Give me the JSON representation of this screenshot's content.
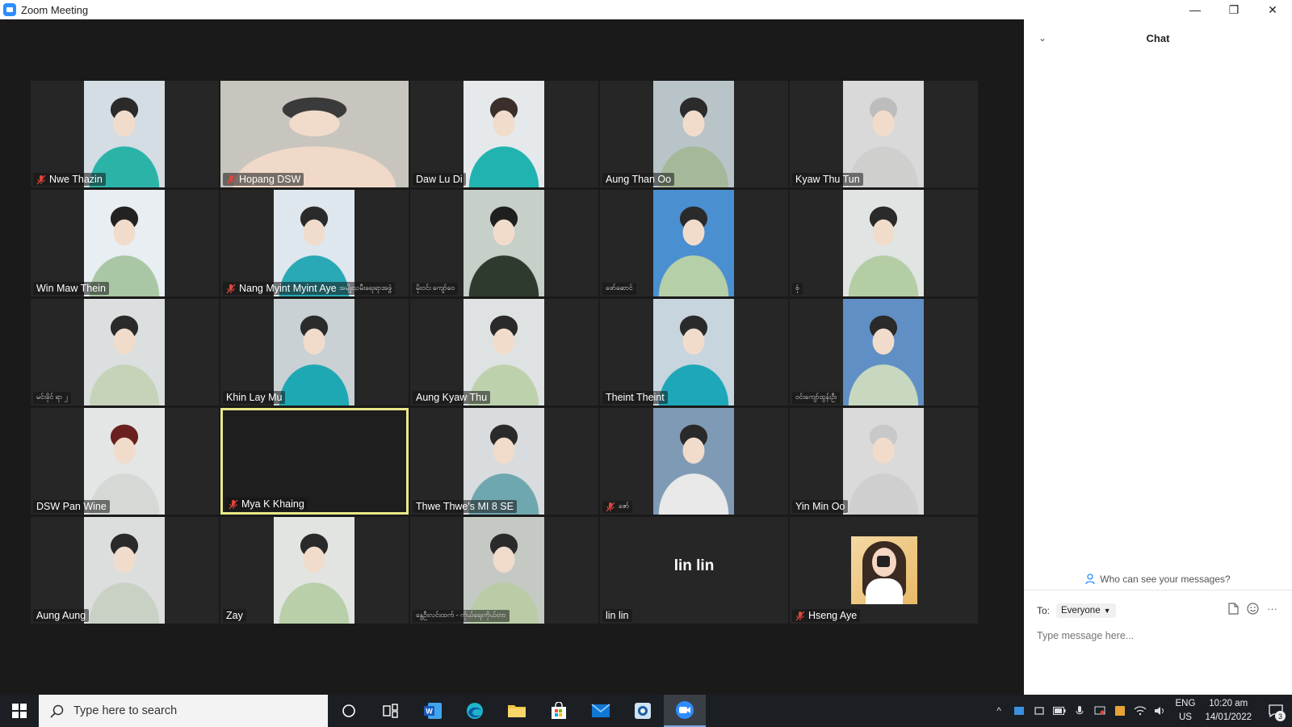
{
  "window": {
    "title": "Zoom Meeting",
    "minimize": "—",
    "restore": "❐",
    "close": "✕"
  },
  "participants": [
    {
      "name": "Nwe Thazin",
      "muted": true,
      "style": "person",
      "colors": [
        "#d4dde4",
        "#2bb3a8",
        "#2a2a2a"
      ]
    },
    {
      "name": "Hopang DSW",
      "muted": true,
      "style": "wide",
      "colors": [
        "#c8c4be",
        "#f1d9c9",
        "#3a3a3a"
      ]
    },
    {
      "name": "Daw Lu Di",
      "muted": false,
      "style": "person",
      "colors": [
        "#e6e9ec",
        "#20b3b0",
        "#3a2f2a"
      ]
    },
    {
      "name": "Aung Than Oo",
      "muted": false,
      "style": "person",
      "colors": [
        "#b9c4c9",
        "#a6b89a",
        "#2b2b2b"
      ]
    },
    {
      "name": "Kyaw Thu Tun",
      "muted": false,
      "style": "person",
      "colors": [
        "#d9d9d9",
        "#cfd0ce",
        "#bdbdbd"
      ]
    },
    {
      "name": "Win Maw Thein",
      "muted": false,
      "style": "person",
      "colors": [
        "#e8eef2",
        "#a9c7a4",
        "#222222"
      ]
    },
    {
      "name": "Nang Myint Myint Aye",
      "suffix": "အမျိုးသမီးရေးရာအဖွဲ့",
      "muted": true,
      "style": "person",
      "colors": [
        "#dfe7ee",
        "#28a9b5",
        "#2a2a2a"
      ]
    },
    {
      "name": "မိုးဝင်း ကျော်ဝေ",
      "muted": false,
      "style": "person",
      "small": true,
      "colors": [
        "#c6cfc8",
        "#2e3a2e",
        "#1f1f1f"
      ]
    },
    {
      "name": "ဖော်ဆောင်",
      "muted": false,
      "style": "person",
      "small": true,
      "colors": [
        "#4a8fd0",
        "#b5cfa8",
        "#2a2a2a"
      ]
    },
    {
      "name": "စုံ",
      "muted": false,
      "style": "person",
      "small": true,
      "colors": [
        "#e0e4e2",
        "#b4cda4",
        "#2a2a2a"
      ]
    },
    {
      "name": "မင်းခိုင် ရာ ၂",
      "muted": false,
      "style": "person",
      "small": true,
      "colors": [
        "#dcdfe0",
        "#c7d3b8",
        "#2a2a2a"
      ]
    },
    {
      "name": "Khin Lay Mu",
      "muted": false,
      "style": "person",
      "colors": [
        "#c9d1d4",
        "#1ea8b3",
        "#2b2b2b"
      ]
    },
    {
      "name": "Aung Kyaw Thu",
      "muted": false,
      "style": "person",
      "colors": [
        "#dfe2e3",
        "#bdd1ad",
        "#2a2a2a"
      ]
    },
    {
      "name": "Theint Theint",
      "muted": false,
      "style": "person",
      "colors": [
        "#c7d5de",
        "#1da7b8",
        "#2a2a2a"
      ]
    },
    {
      "name": "ဝင်းကျော်ထွန်းဦး",
      "muted": false,
      "style": "person",
      "small": true,
      "colors": [
        "#5f8fc4",
        "#c8d8c0",
        "#2a2a2a"
      ]
    },
    {
      "name": "DSW Pan Wine",
      "muted": false,
      "style": "person",
      "colors": [
        "#e3e6e4",
        "#d5d9d6",
        "#6b2020"
      ]
    },
    {
      "name": "Mya K Khaing",
      "muted": true,
      "style": "blank",
      "active": true,
      "colors": [
        "#1e1e1e",
        "#1e1e1e",
        "#1e1e1e"
      ]
    },
    {
      "name": "Thwe Thwe's MI 8 SE",
      "muted": false,
      "style": "person",
      "colors": [
        "#d9dcde",
        "#6fa7b0",
        "#2a2a2a"
      ]
    },
    {
      "name": "ဇော်",
      "muted": true,
      "style": "person",
      "small": true,
      "colors": [
        "#7f9ab5",
        "#e9e9e9",
        "#2a2a2a"
      ]
    },
    {
      "name": "Yin Min Oo",
      "muted": false,
      "style": "person",
      "colors": [
        "#dadada",
        "#cfcfcf",
        "#c8c8c8"
      ]
    },
    {
      "name": "Aung Aung",
      "muted": false,
      "style": "person",
      "colors": [
        "#dcdedd",
        "#c9d0c4",
        "#2a2a2a"
      ]
    },
    {
      "name": "Zay",
      "muted": false,
      "style": "person",
      "colors": [
        "#e2e4e2",
        "#b8cfa9",
        "#2a2a2a"
      ]
    },
    {
      "name": "နွေဦးလင်းထက် - ကိုယ်ရေးကိုယ်တာ",
      "muted": false,
      "style": "person",
      "small": true,
      "colors": [
        "#c5c9c4",
        "#b9cca6",
        "#2a2a2a"
      ]
    },
    {
      "name": "lin lin",
      "center": "lin lin",
      "muted": false,
      "style": "nocam",
      "colors": [
        "#262626",
        "#262626",
        "#262626"
      ]
    },
    {
      "name": "Hseng Aye",
      "muted": true,
      "style": "avatar",
      "colors": [
        "#262626",
        "#262626",
        "#262626"
      ]
    }
  ],
  "chat": {
    "collapse_icon": "⌄",
    "title": "Chat",
    "who_can_see": "Who can see your messages?",
    "to_label": "To:",
    "to_value": "Everyone",
    "placeholder": "Type message here...",
    "more": "···"
  },
  "taskbar": {
    "search_placeholder": "Type here to search",
    "lang_top": "ENG",
    "lang_bottom": "US",
    "time": "10:20 am",
    "date": "14/01/2022",
    "notification_count": "3",
    "apps": [
      "cortana-icon",
      "task-view-icon",
      "word-icon",
      "edge-icon",
      "file-explorer-icon",
      "store-icon",
      "mail-icon",
      "photos-icon",
      "zoom-icon"
    ]
  },
  "colors": {
    "accent": "#2d8cff",
    "active_speaker": "#e8e88a",
    "muted_mic": "#e0453a"
  }
}
